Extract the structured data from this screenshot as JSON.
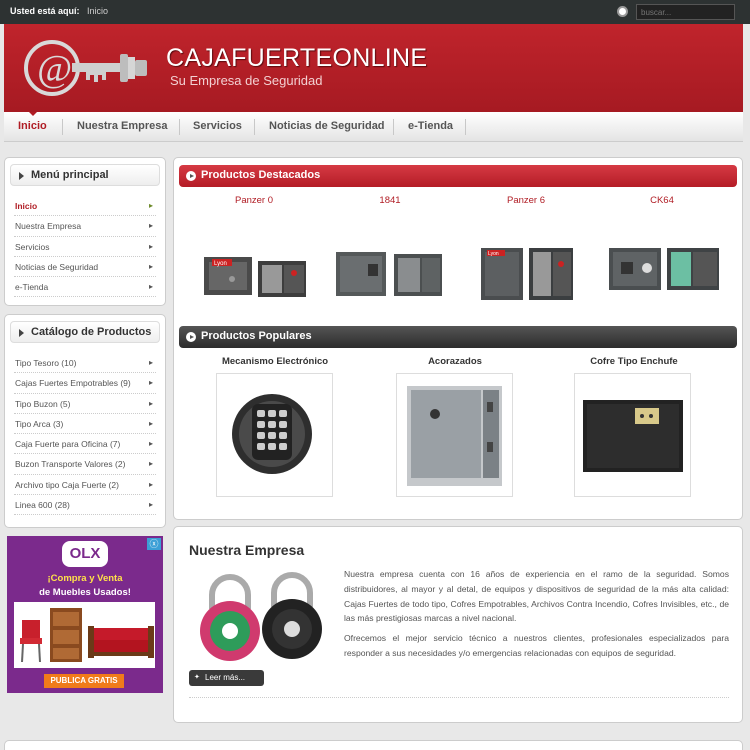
{
  "breadcrumb": {
    "label": "Usted está aquí:",
    "home": "Inicio"
  },
  "search": {
    "placeholder": "buscar..."
  },
  "header": {
    "title": "CAJAFUERTEONLINE",
    "tagline": "Su Empresa de Seguridad"
  },
  "nav": {
    "items": [
      "Inicio",
      "Nuestra Empresa",
      "Servicios",
      "Noticias de Seguridad",
      "e-Tienda"
    ],
    "active": "Inicio"
  },
  "menu_principal": {
    "title": "Menú principal",
    "items": [
      "Inicio",
      "Nuestra Empresa",
      "Servicios",
      "Noticias de Seguridad",
      "e-Tienda"
    ]
  },
  "catalogo": {
    "title": "Catálogo de Productos",
    "items": [
      "Tipo Tesoro (10)",
      "Cajas Fuertes Empotrables (9)",
      "Tipo Buzon (5)",
      "Tipo Arca (3)",
      "Caja Fuerte para Oficina (7)",
      "Buzon Transporte Valores (2)",
      "Archivo tipo Caja Fuerte (2)",
      "Linea 600 (28)"
    ]
  },
  "ad": {
    "logo": "OLX",
    "line1": "¡Compra y Venta",
    "line2": "de Muebles Usados!",
    "button": "PUBLICA GRATIS",
    "close": "ⓧ"
  },
  "destacados": {
    "title": "Productos Destacados",
    "products": [
      "Panzer 0",
      "1841",
      "Panzer 6",
      "CK64"
    ]
  },
  "populares": {
    "title": "Productos Populares",
    "products": [
      "Mecanismo Electrónico",
      "Acorazados",
      "Cofre Tipo Enchufe"
    ]
  },
  "empresa": {
    "title": "Nuestra Empresa",
    "p1": "Nuestra empresa cuenta con 16 años de experiencia en el ramo de la seguridad. Somos distribuidores, al mayor y al detal, de equipos y dispositivos de seguridad de la más alta calidad: Cajas Fuertes de todo tipo, Cofres Empotrables, Archivos Contra Incendio, Cofres Invisibles, etc., de las más prestigiosas marcas a nivel nacional.",
    "p2": "Ofrecemos el mejor servicio técnico a nuestros clientes, profesionales especializados para responder a sus necesidades y/o emergencias relacionadas con equipos de seguridad.",
    "more": "Leer más..."
  },
  "colors": {
    "brand_red": "#b01c24",
    "header_red": "#c0242c",
    "topbar": "#2d3232"
  }
}
